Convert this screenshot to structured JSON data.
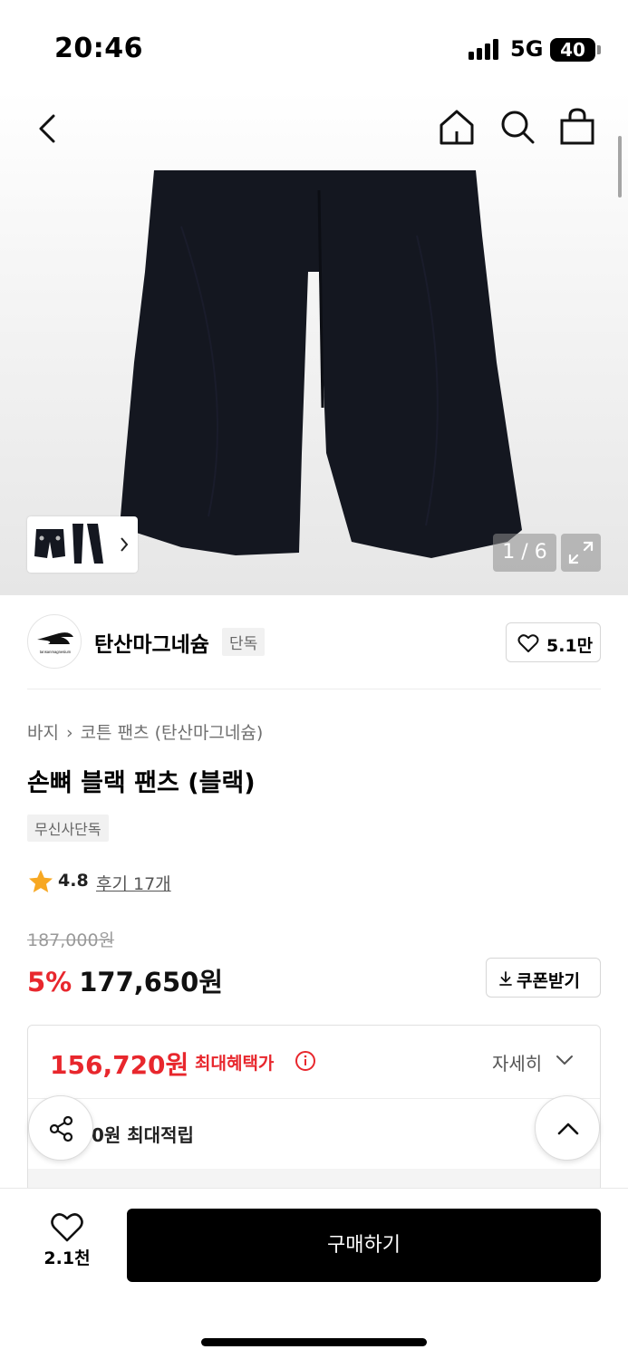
{
  "status": {
    "time": "20:46",
    "network": "5G",
    "battery": "40"
  },
  "gallery": {
    "counter": "1 / 6"
  },
  "brand": {
    "name": "탄산마그네슘",
    "tag": "단독",
    "likes": "5.1만",
    "logo_text": "tansanmagnesium"
  },
  "breadcrumb": {
    "category": "바지",
    "subcategory": "코튼 팬츠 (탄산마그네슘)"
  },
  "product": {
    "title": "손뼈 블랙 팬츠 (블랙)",
    "badge": "무신사단독"
  },
  "rating": {
    "score": "4.8",
    "reviews": "후기 17개"
  },
  "price": {
    "original": "187,000원",
    "discount": "5%",
    "sale": "177,650원",
    "coupon_label": "쿠폰받기"
  },
  "benefit": {
    "max_price": "156,720원",
    "label": "최대혜택가",
    "detail": "자세히",
    "points": "0원 최대적립"
  },
  "bottom": {
    "wish_count": "2.1천",
    "buy_label": "구매하기"
  },
  "colors": {
    "accent_red": "#e8272d",
    "buy_button": "#000000",
    "product_dark": "#141720"
  },
  "icons": [
    "back-icon",
    "home-icon",
    "search-icon",
    "bag-icon",
    "expand-icon",
    "heart-icon",
    "download-icon",
    "info-icon",
    "chevron-down-icon",
    "share-icon",
    "chevron-up-icon",
    "star-icon"
  ]
}
